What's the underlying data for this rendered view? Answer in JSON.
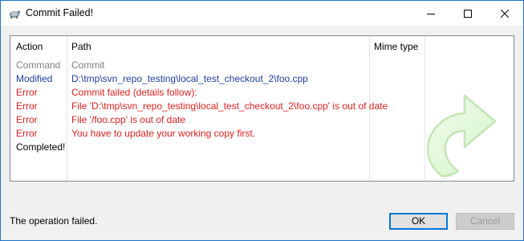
{
  "window": {
    "title": "Commit Failed!"
  },
  "titlebar_buttons": {
    "minimize": "minimize-icon",
    "maximize": "maximize-icon",
    "close": "close-icon"
  },
  "list": {
    "columns": [
      "Action",
      "Path",
      "Mime type"
    ],
    "rows": [
      {
        "action": "Command",
        "path": "Commit",
        "color": "#808080"
      },
      {
        "action": "Modified",
        "path": "D:\\tmp\\svn_repo_testing\\local_test_checkout_2\\foo.cpp",
        "color": "#1f3ca8"
      },
      {
        "action": "Error",
        "path": "Commit failed (details follow):",
        "color": "#e31e1e"
      },
      {
        "action": "Error",
        "path": "File 'D:\\tmp\\svn_repo_testing\\local_test_checkout_2\\foo.cpp' is out of date",
        "color": "#e31e1e"
      },
      {
        "action": "Error",
        "path": "File '/foo.cpp' is out of date",
        "color": "#e31e1e"
      },
      {
        "action": "Error",
        "path": "You have to update your working copy first.",
        "color": "#e31e1e"
      },
      {
        "action": "Completed!",
        "path": "",
        "color": "#000000"
      }
    ]
  },
  "status_text": "The operation failed.",
  "buttons": {
    "ok": "OK",
    "cancel": "Cancel"
  },
  "colors": {
    "accent": "#0078d7",
    "error": "#e31e1e",
    "modified": "#1f3ca8",
    "command": "#808080"
  }
}
